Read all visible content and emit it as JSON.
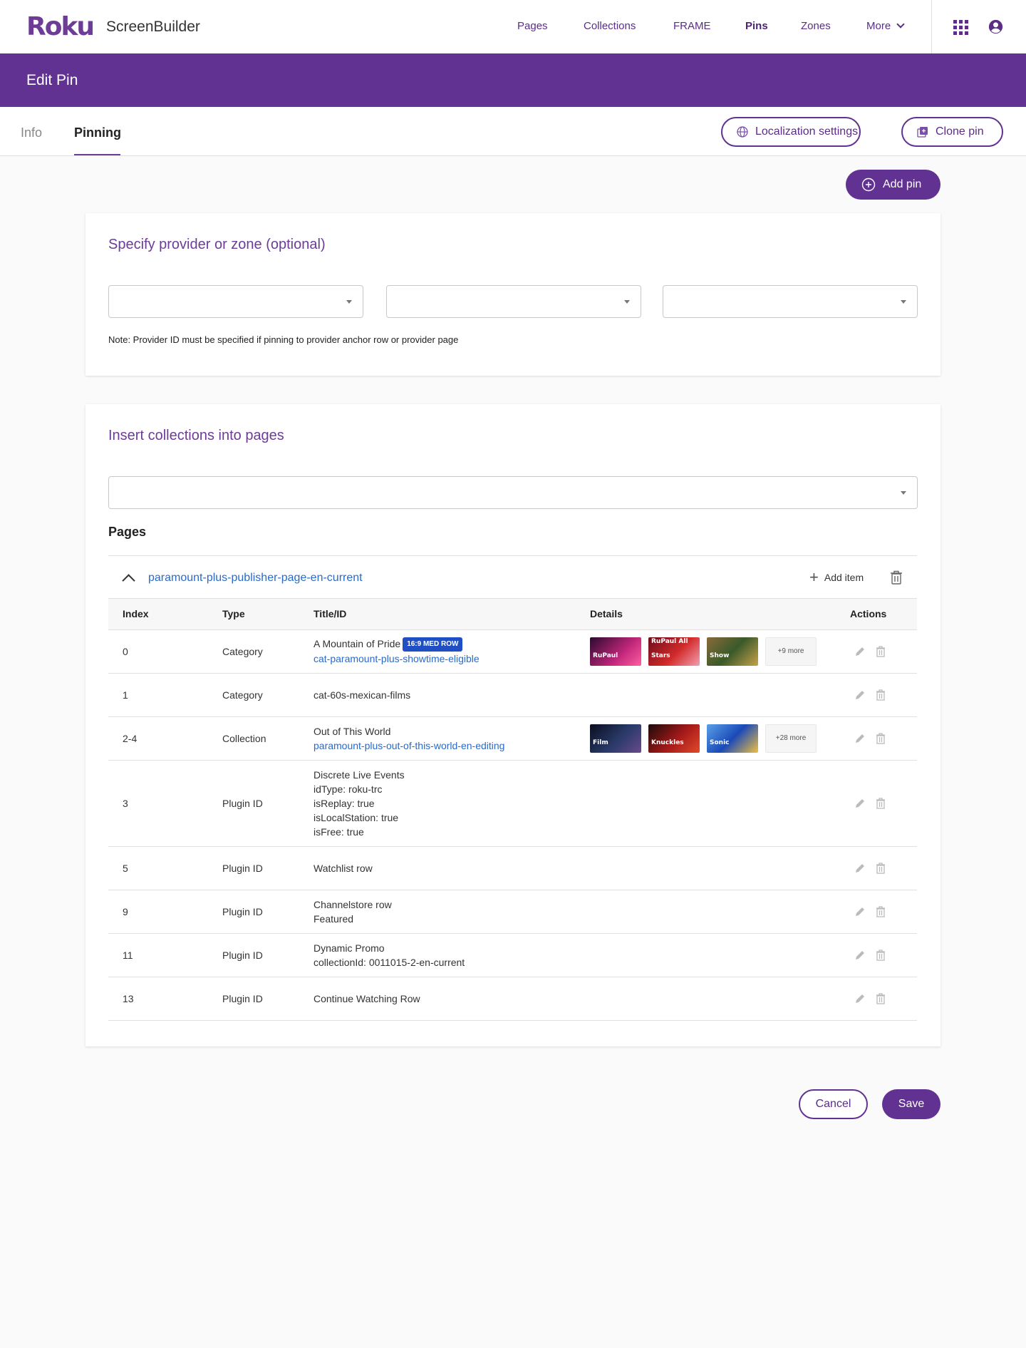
{
  "nav": {
    "logo": "Roku",
    "product": "ScreenBuilder",
    "links": [
      "Pages",
      "Collections",
      "FRAME",
      "Pins",
      "Zones",
      "More"
    ],
    "active": "Pins",
    "apps_icon": "apps-grid-icon",
    "user_icon": "account-circle-icon"
  },
  "header": {
    "title": "Edit Pin"
  },
  "tabs": {
    "info": "Info",
    "pinning": "Pinning",
    "active": "Pinning"
  },
  "actions": {
    "localization": "Localization settings",
    "clone": "Clone pin",
    "add_pin": "Add pin"
  },
  "provider_section": {
    "title": "Specify provider or zone (optional)",
    "selects": [
      "",
      "",
      ""
    ],
    "note": "Note: Provider ID must be specified if pinning to provider anchor row or provider page"
  },
  "collections_section": {
    "title": "Insert collections into pages",
    "select_value": "",
    "pages_label": "Pages",
    "page_group": {
      "name": "paramount-plus-publisher-page-en-current",
      "add_item": "Add item"
    },
    "columns": [
      "Index",
      "Type",
      "Title/ID",
      "Details",
      "Actions"
    ],
    "rows": [
      {
        "index": "0",
        "type": "Category",
        "title": "A Mountain of Pride",
        "badge": "16:9 MED ROW",
        "id": "cat-paramount-plus-showtime-eligible",
        "thumbs": [
          "RuPaul",
          "RuPaul All Stars",
          "Show"
        ],
        "more": "+9 more"
      },
      {
        "index": "1",
        "type": "Category",
        "title": "cat-60s-mexican-films"
      },
      {
        "index": "2-4",
        "type": "Collection",
        "title": "Out of This World",
        "id": "paramount-plus-out-of-this-world-en-editing",
        "thumbs": [
          "Film",
          "Knuckles",
          "Sonic"
        ],
        "more": "+28 more"
      },
      {
        "index": "3",
        "type": "Plugin ID",
        "lines": [
          "Discrete Live Events",
          "idType: roku-trc",
          "isReplay: true",
          "isLocalStation: true",
          "isFree: true"
        ]
      },
      {
        "index": "5",
        "type": "Plugin ID",
        "lines": [
          "Watchlist row"
        ]
      },
      {
        "index": "9",
        "type": "Plugin ID",
        "lines": [
          "Channelstore row",
          "Featured"
        ]
      },
      {
        "index": "11",
        "type": "Plugin ID",
        "lines": [
          "Dynamic Promo",
          "collectionId: 0011015-2-en-current"
        ]
      },
      {
        "index": "13",
        "type": "Plugin ID",
        "lines": [
          "Continue Watching Row"
        ]
      }
    ]
  },
  "footer": {
    "cancel": "Cancel",
    "save": "Save"
  },
  "colors": {
    "brand": "#623292",
    "link": "#2a6ac8",
    "badge": "#1f4fc2"
  }
}
